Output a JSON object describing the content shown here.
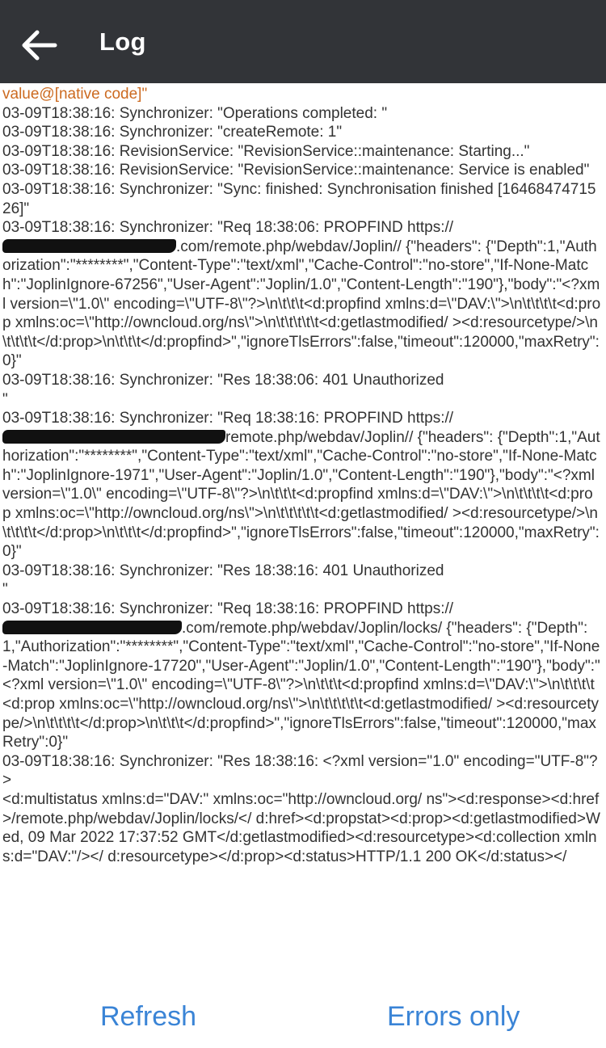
{
  "header": {
    "title": "Log",
    "back_icon": "arrow-left-icon"
  },
  "log": [
    {
      "text": "value@[native code]\"",
      "level": "error"
    },
    {
      "text": "03-09T18:38:16: Synchronizer: \"Operations completed: \"",
      "level": "info"
    },
    {
      "text": "03-09T18:38:16: Synchronizer: \"createRemote: 1\"",
      "level": "info"
    },
    {
      "text": "03-09T18:38:16: RevisionService: \"RevisionService::maintenance: Starting...\"",
      "level": "info"
    },
    {
      "text": "03-09T18:38:16: RevisionService: \"RevisionService::maintenance: Service is enabled\"",
      "level": "info"
    },
    {
      "text": "03-09T18:38:16: Synchronizer: \"Sync: finished: Synchronisation finished [1646847471526]\"",
      "level": "info"
    },
    {
      "text": "03-09T18:38:16: Synchronizer: \"Req 18:38:06: PROPFIND https://",
      "redact": 215,
      "text2": ".com/remote.php/webdav/Joplin// {\"headers\": {\"Depth\":1,\"Authorization\":\"********\",\"Content-Type\":\"text/xml\",\"Cache-Control\":\"no-store\",\"If-None-Match\":\"JoplinIgnore-67256\",\"User-Agent\":\"Joplin/1.0\",\"Content-Length\":\"190\"},\"body\":\"<?xml version=\\\"1.0\\\" encoding=\\\"UTF-8\\\"?>\\n\\t\\t\\t<d:propfind xmlns:d=\\\"DAV:\\\">\\n\\t\\t\\t\\t<d:prop xmlns:oc=\\\"http://owncloud.org/ns\\\">\\n\\t\\t\\t\\t\\t<d:getlastmodified/ ><d:resourcetype/>\\n\\t\\t\\t\\t</d:prop>\\n\\t\\t\\t</d:propfind>\",\"ignoreTlsErrors\":false,\"timeout\":120000,\"maxRetry\":0}\"",
      "level": "info"
    },
    {
      "text": "03-09T18:38:16: Synchronizer: \"Res 18:38:06: 401 Unauthorized\n\"",
      "level": "info"
    },
    {
      "text": "03-09T18:38:16: Synchronizer: \"Req 18:38:16: PROPFIND https://",
      "redact": 276,
      "text2": "remote.php/webdav/Joplin// {\"headers\": {\"Depth\":1,\"Authorization\":\"********\",\"Content-Type\":\"text/xml\",\"Cache-Control\":\"no-store\",\"If-None-Match\":\"JoplinIgnore-1971\",\"User-Agent\":\"Joplin/1.0\",\"Content-Length\":\"190\"},\"body\":\"<?xml version=\\\"1.0\\\" encoding=\\\"UTF-8\\\"?>\\n\\t\\t\\t<d:propfind xmlns:d=\\\"DAV:\\\">\\n\\t\\t\\t\\t<d:prop xmlns:oc=\\\"http://owncloud.org/ns\\\">\\n\\t\\t\\t\\t\\t<d:getlastmodified/ ><d:resourcetype/>\\n\\t\\t\\t\\t</d:prop>\\n\\t\\t\\t</d:propfind>\",\"ignoreTlsErrors\":false,\"timeout\":120000,\"maxRetry\":0}\"",
      "level": "info"
    },
    {
      "text": "03-09T18:38:16: Synchronizer: \"Res 18:38:16: 401 Unauthorized\n\"",
      "level": "info"
    },
    {
      "text": "03-09T18:38:16: Synchronizer: \"Req 18:38:16: PROPFIND https://",
      "redact": 222,
      "text2": ".com/remote.php/webdav/Joplin/locks/ {\"headers\": {\"Depth\":1,\"Authorization\":\"********\",\"Content-Type\":\"text/xml\",\"Cache-Control\":\"no-store\",\"If-None-Match\":\"JoplinIgnore-17720\",\"User-Agent\":\"Joplin/1.0\",\"Content-Length\":\"190\"},\"body\":\"<?xml version=\\\"1.0\\\" encoding=\\\"UTF-8\\\"?>\\n\\t\\t\\t<d:propfind xmlns:d=\\\"DAV:\\\">\\n\\t\\t\\t\\t<d:prop xmlns:oc=\\\"http://owncloud.org/ns\\\">\\n\\t\\t\\t\\t\\t<d:getlastmodified/ ><d:resourcetype/>\\n\\t\\t\\t\\t</d:prop>\\n\\t\\t\\t</d:propfind>\",\"ignoreTlsErrors\":false,\"timeout\":120000,\"maxRetry\":0}\"",
      "level": "info"
    },
    {
      "text": "03-09T18:38:16: Synchronizer: \"Res 18:38:16: <?xml version=\"1.0\" encoding=\"UTF-8\"?>\n<d:multistatus xmlns:d=\"DAV:\" xmlns:oc=\"http://owncloud.org/ ns\"><d:response><d:href>/remote.php/webdav/Joplin/locks/</ d:href><d:propstat><d:prop><d:getlastmodified>Wed, 09 Mar 2022 17:37:52 GMT</d:getlastmodified><d:resourcetype><d:collection xmlns:d=\"DAV:\"/></ d:resourcetype></d:prop><d:status>HTTP/1.1 200 OK</d:status></",
      "level": "info"
    }
  ],
  "footer": {
    "refresh_label": "Refresh",
    "errors_label": "Errors only"
  }
}
